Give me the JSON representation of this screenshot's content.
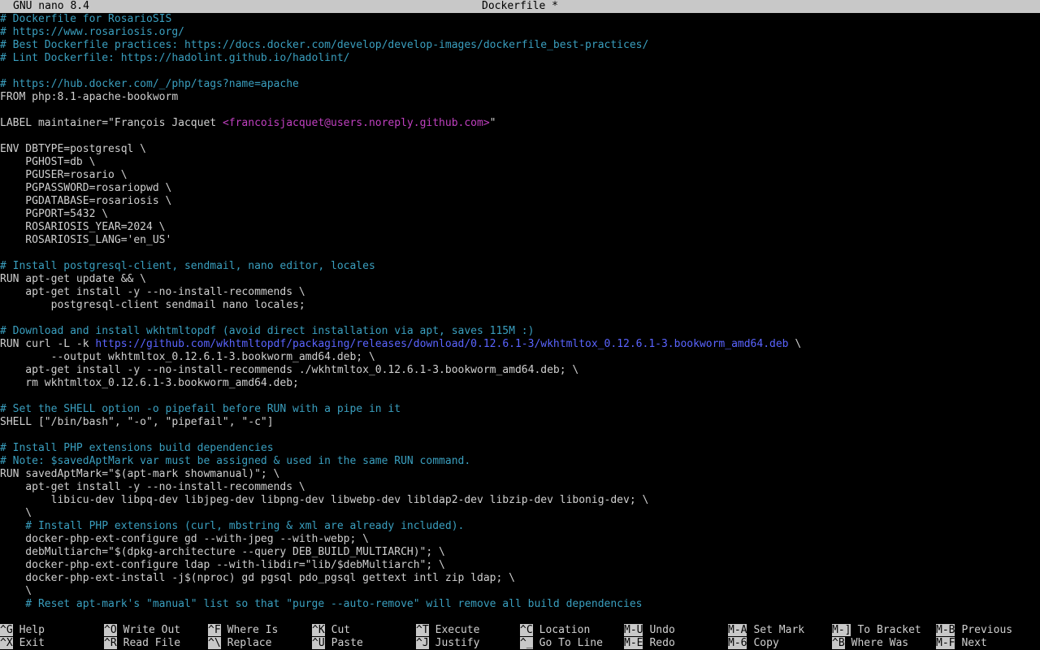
{
  "titlebar": {
    "app_name": "GNU nano 8.4",
    "file_name": "Dockerfile *"
  },
  "editor": {
    "lines": [
      [
        {
          "t": "# Dockerfile for RosarioSIS",
          "c": "comment"
        }
      ],
      [
        {
          "t": "# https://www.rosariosis.org/",
          "c": "comment"
        }
      ],
      [
        {
          "t": "# Best Dockerfile practices: https://docs.docker.com/develop/develop-images/dockerfile_best-practices/",
          "c": "comment"
        }
      ],
      [
        {
          "t": "# Lint Dockerfile: https://hadolint.github.io/hadolint/",
          "c": "comment"
        }
      ],
      [],
      [
        {
          "t": "# https://hub.docker.com/_/php/tags?name=apache",
          "c": "comment"
        }
      ],
      [
        {
          "t": "FROM php:8.1-apache-bookworm",
          "c": "text"
        }
      ],
      [],
      [
        {
          "t": "LABEL maintainer=\"François Jacquet ",
          "c": "text"
        },
        {
          "t": "<francoisjacquet@users.noreply.github.com>",
          "c": "email"
        },
        {
          "t": "\"",
          "c": "text"
        }
      ],
      [],
      [
        {
          "t": "ENV DBTYPE=postgresql \\",
          "c": "text"
        }
      ],
      [
        {
          "t": "    PGHOST=db \\",
          "c": "text"
        }
      ],
      [
        {
          "t": "    PGUSER=rosario \\",
          "c": "text"
        }
      ],
      [
        {
          "t": "    PGPASSWORD=rosariopwd \\",
          "c": "text"
        }
      ],
      [
        {
          "t": "    PGDATABASE=rosariosis \\",
          "c": "text"
        }
      ],
      [
        {
          "t": "    PGPORT=5432 \\",
          "c": "text"
        }
      ],
      [
        {
          "t": "    ROSARIOSIS_YEAR=2024 \\",
          "c": "text"
        }
      ],
      [
        {
          "t": "    ROSARIOSIS_LANG='en_US'",
          "c": "text"
        }
      ],
      [],
      [
        {
          "t": "# Install postgresql-client, sendmail, nano editor, locales",
          "c": "comment"
        }
      ],
      [
        {
          "t": "RUN apt-get update && \\",
          "c": "text"
        }
      ],
      [
        {
          "t": "    apt-get install -y --no-install-recommends \\",
          "c": "text"
        }
      ],
      [
        {
          "t": "        postgresql-client sendmail nano locales;",
          "c": "text"
        }
      ],
      [],
      [
        {
          "t": "# Download and install wkhtmltopdf (avoid direct installation via apt, saves 115M :)",
          "c": "comment"
        }
      ],
      [
        {
          "t": "RUN curl -L -k ",
          "c": "text"
        },
        {
          "t": "https://github.com/wkhtmltopdf/packaging/releases/download/0.12.6.1-3/wkhtmltox_0.12.6.1-3.bookworm_amd64.deb",
          "c": "url"
        },
        {
          "t": " \\",
          "c": "text"
        }
      ],
      [
        {
          "t": "        --output wkhtmltox_0.12.6.1-3.bookworm_amd64.deb; \\",
          "c": "text"
        }
      ],
      [
        {
          "t": "    apt-get install -y --no-install-recommends ./wkhtmltox_0.12.6.1-3.bookworm_amd64.deb; \\",
          "c": "text"
        }
      ],
      [
        {
          "t": "    rm wkhtmltox_0.12.6.1-3.bookworm_amd64.deb;",
          "c": "text"
        }
      ],
      [],
      [
        {
          "t": "# Set the SHELL option -o pipefail before RUN with a pipe in it",
          "c": "comment"
        }
      ],
      [
        {
          "t": "SHELL [\"/bin/bash\", \"-o\", \"pipefail\", \"-c\"]",
          "c": "text"
        }
      ],
      [],
      [
        {
          "t": "# Install PHP extensions build dependencies",
          "c": "comment"
        }
      ],
      [
        {
          "t": "# Note: $savedAptMark var must be assigned & used in the same RUN command.",
          "c": "comment"
        }
      ],
      [
        {
          "t": "RUN savedAptMark=\"$(apt-mark showmanual)\"; \\",
          "c": "text"
        }
      ],
      [
        {
          "t": "    apt-get install -y --no-install-recommends \\",
          "c": "text"
        }
      ],
      [
        {
          "t": "        libicu-dev libpq-dev libjpeg-dev libpng-dev libwebp-dev libldap2-dev libzip-dev libonig-dev; \\",
          "c": "text"
        }
      ],
      [
        {
          "t": "    \\",
          "c": "text"
        }
      ],
      [
        {
          "t": "    # Install PHP extensions (curl, mbstring & xml are already included).",
          "c": "comment"
        }
      ],
      [
        {
          "t": "    docker-php-ext-configure gd --with-jpeg --with-webp; \\",
          "c": "text"
        }
      ],
      [
        {
          "t": "    debMultiarch=\"$(dpkg-architecture --query DEB_BUILD_MULTIARCH)\"; \\",
          "c": "text"
        }
      ],
      [
        {
          "t": "    docker-php-ext-configure ldap --with-libdir=\"lib/$debMultiarch\"; \\",
          "c": "text"
        }
      ],
      [
        {
          "t": "    docker-php-ext-install -j$(nproc) gd pgsql pdo_pgsql gettext intl zip ldap; \\",
          "c": "text"
        }
      ],
      [
        {
          "t": "    \\",
          "c": "text"
        }
      ],
      [
        {
          "t": "    # Reset apt-mark's \"manual\" list so that \"purge --auto-remove\" will remove all build dependencies",
          "c": "comment"
        }
      ],
      []
    ]
  },
  "shortcuts": [
    [
      {
        "key": "^G",
        "label": "Help"
      },
      {
        "key": "^X",
        "label": "Exit"
      }
    ],
    [
      {
        "key": "^O",
        "label": "Write Out"
      },
      {
        "key": "^R",
        "label": "Read File"
      }
    ],
    [
      {
        "key": "^F",
        "label": "Where Is"
      },
      {
        "key": "^\\",
        "label": "Replace"
      }
    ],
    [
      {
        "key": "^K",
        "label": "Cut"
      },
      {
        "key": "^U",
        "label": "Paste"
      }
    ],
    [
      {
        "key": "^T",
        "label": "Execute"
      },
      {
        "key": "^J",
        "label": "Justify"
      }
    ],
    [
      {
        "key": "^C",
        "label": "Location"
      },
      {
        "key": "^_",
        "label": "Go To Line"
      }
    ],
    [
      {
        "key": "M-U",
        "label": "Undo"
      },
      {
        "key": "M-E",
        "label": "Redo"
      }
    ],
    [
      {
        "key": "M-A",
        "label": "Set Mark"
      },
      {
        "key": "M-6",
        "label": "Copy"
      }
    ],
    [
      {
        "key": "M-]",
        "label": "To Bracket"
      },
      {
        "key": "^B",
        "label": "Where Was"
      }
    ],
    [
      {
        "key": "M-B",
        "label": "Previous"
      },
      {
        "key": "M-F",
        "label": "Next"
      }
    ]
  ]
}
